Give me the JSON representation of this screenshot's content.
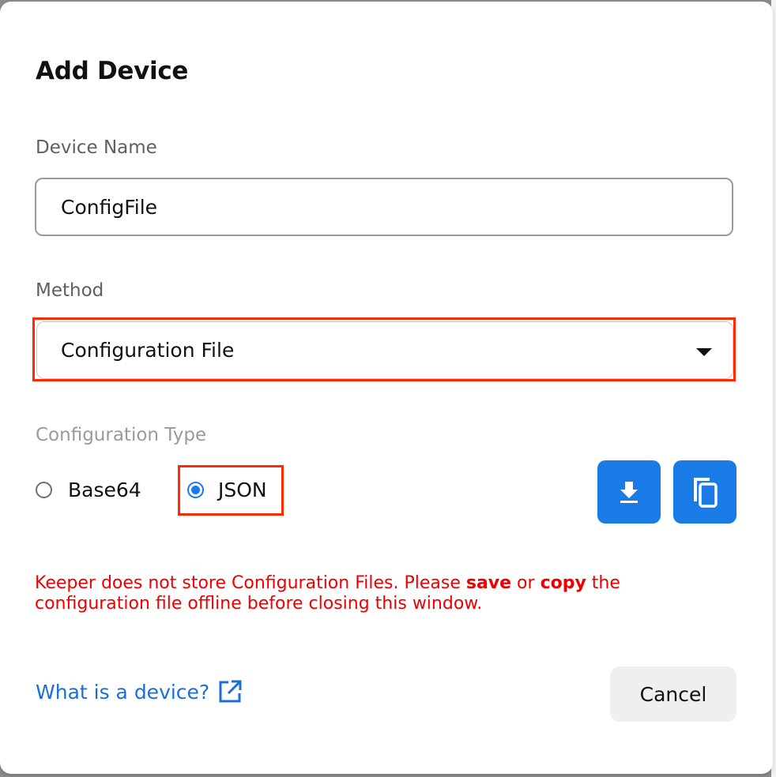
{
  "modal": {
    "title": "Add Device"
  },
  "device_name": {
    "label": "Device Name",
    "value": "ConfigFile"
  },
  "method": {
    "label": "Method",
    "selected": "Configuration File"
  },
  "configuration_type": {
    "label": "Configuration Type",
    "options": [
      {
        "label": "Base64",
        "checked": false
      },
      {
        "label": "JSON",
        "checked": true
      }
    ]
  },
  "actions": {
    "download_icon": "download-icon",
    "copy_icon": "copy-icon"
  },
  "warning": {
    "part1": "Keeper does not store Configuration Files. Please ",
    "save": "save",
    "part2": " or ",
    "copy": "copy",
    "part3": " the configuration file offline before closing this window."
  },
  "footer": {
    "help_link": "What is a device?",
    "cancel_label": "Cancel"
  },
  "colors": {
    "accent": "#1a7ae6",
    "warning": "#ee0000",
    "highlight": "#ff2a00",
    "link": "#1a6fd6"
  }
}
